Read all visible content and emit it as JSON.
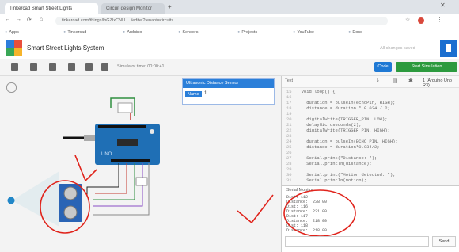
{
  "browser": {
    "tabs": [
      {
        "label": "Tinkercad Smart Street Lights",
        "active": true
      },
      {
        "label": "Circuit design Monitor",
        "active": false
      }
    ],
    "url": "tinkercad.com/things/lhGZIxCNU ... /editel?tenant=circuits",
    "bookmarks": [
      "Apps",
      "Tinkercad",
      "Arduino",
      "Sensors",
      "Projects",
      "YouTube",
      "Docs"
    ]
  },
  "app": {
    "title": "Smart Street Lights System",
    "save_status": "All changes saved",
    "sim_time": "Simulator time: 00:00:41",
    "code_button": "Code",
    "start_button": "Start Simulation"
  },
  "sensor_popup": {
    "title": "Ultrasonic Distance Sensor",
    "label": "Name",
    "value": "1"
  },
  "code_panel": {
    "mode": "Text",
    "selector": "1 (Arduino Uno R3)",
    "lines": [
      "  void loop() {",
      "",
      "    duration = pulseIn(echoPin, HIGH);",
      "    distance = duration * 0.034 / 2;",
      "",
      "    digitalWrite(TRIGGER_PIN, LOW);",
      "    delayMicroseconds(2);",
      "    digitalWrite(TRIGGER_PIN, HIGH);",
      "",
      "    duration = pulseIn(ECHO_PIN, HIGH);",
      "    distance = duration*0.034/2;",
      "",
      "    Serial.print(\"Distance: \");",
      "    Serial.println(distance);",
      "",
      "    Serial.print(\"Motion detected: \");",
      "    Serial.println(motion);"
    ]
  },
  "serial_monitor": {
    "title": "Serial Monitor",
    "lines": [
      "Dist: 112",
      "Distance:  238.00",
      "Dist: 116",
      "Distance:  231.00",
      "Dist: 117",
      "Distance:  218.00",
      "Dist: 118",
      "Distance:  218.00"
    ],
    "send_label": "Send"
  },
  "colors": {
    "annotation": "#e0231b",
    "arduino_board": "#1f6fb5",
    "primary_blue": "#2b7fd9",
    "start_green": "#2c9a3e"
  }
}
